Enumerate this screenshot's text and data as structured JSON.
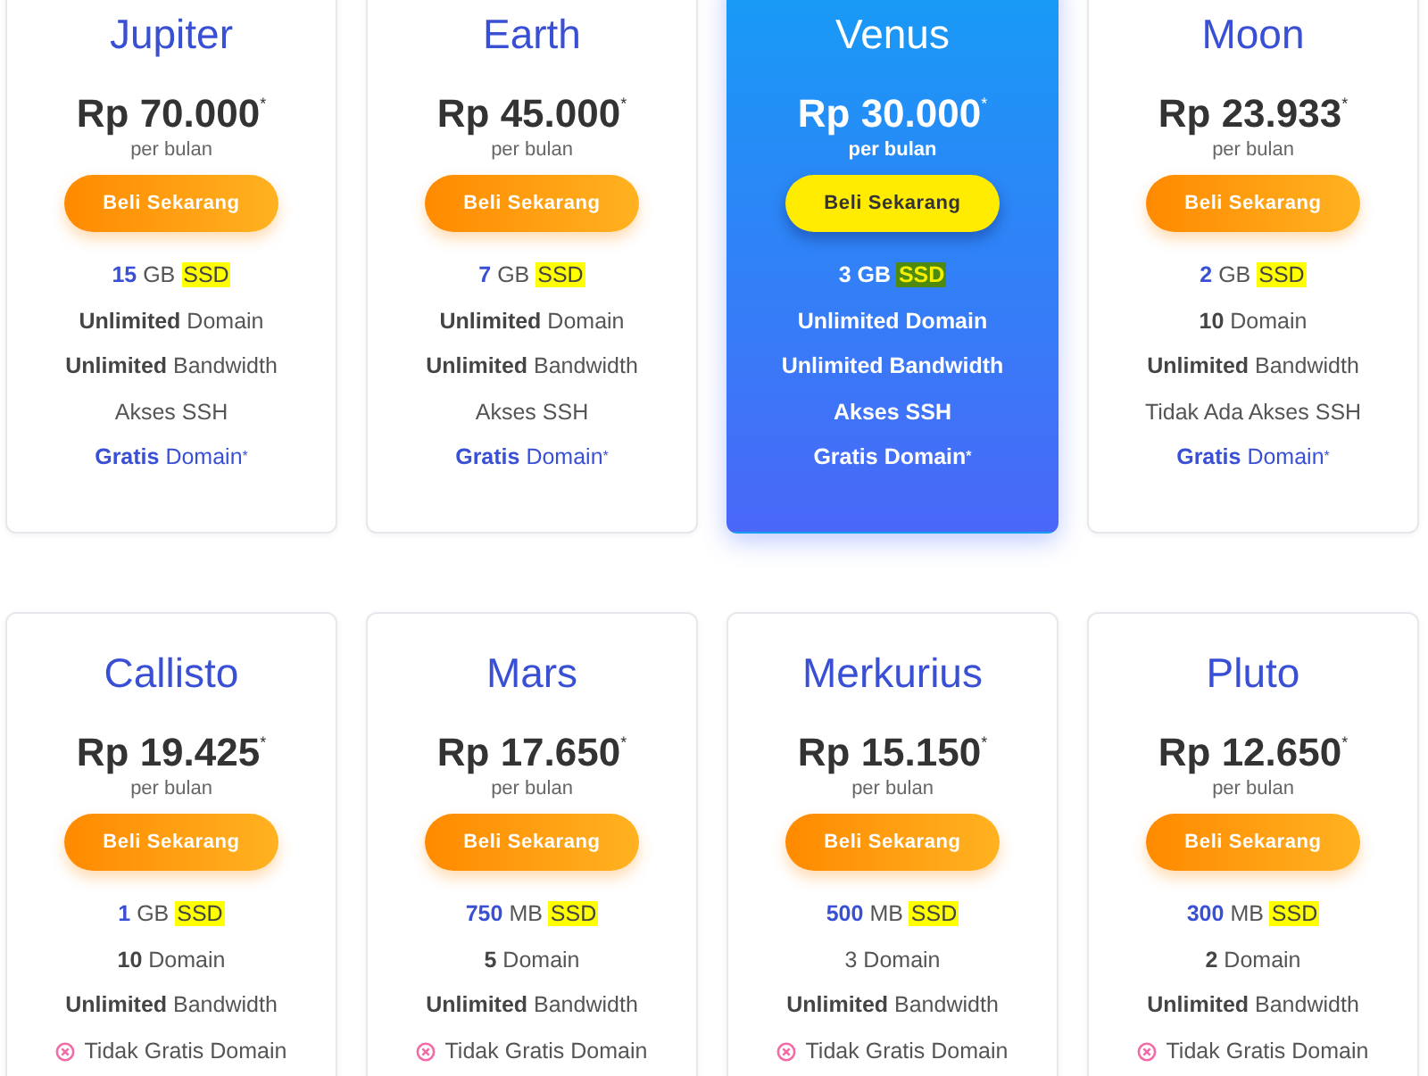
{
  "plans": [
    {
      "name": "Jupiter",
      "price": "Rp 70.000$^{*}$",
      "period": "per bulan",
      "button": "Beli Sekarang",
      "highlighted": false,
      "features": [
        {
          "kind": "storage",
          "amount": "15",
          "unit": "GB",
          "tag": "SSD"
        },
        {
          "kind": "text",
          "text": "**Unlimited** Domain"
        },
        {
          "kind": "text",
          "text": "**Unlimited** Bandwidth"
        },
        {
          "kind": "text",
          "text": "Akses SSH"
        },
        {
          "kind": "promo",
          "text": "**Gratis** Domain$^{*}$"
        }
      ]
    },
    {
      "name": "Earth",
      "price": "Rp 45.000$^{*}$",
      "period": "per bulan",
      "button": "Beli Sekarang",
      "highlighted": false,
      "features": [
        {
          "kind": "storage",
          "amount": "7",
          "unit": "GB",
          "tag": "SSD"
        },
        {
          "kind": "text",
          "text": "**Unlimited** Domain"
        },
        {
          "kind": "text",
          "text": "**Unlimited** Bandwidth"
        },
        {
          "kind": "text",
          "text": "Akses SSH"
        },
        {
          "kind": "promo",
          "text": "**Gratis** Domain$^{*}$"
        }
      ]
    },
    {
      "name": "Venus",
      "price": "Rp 30.000$^{*}$",
      "period": "per bulan",
      "button": "Beli Sekarang",
      "highlighted": true,
      "features": [
        {
          "kind": "storage",
          "amount": "3",
          "unit": "GB",
          "tag": "SSD"
        },
        {
          "kind": "text",
          "text": "**Unlimited Domain**"
        },
        {
          "kind": "text",
          "text": "**Unlimited Bandwidth**"
        },
        {
          "kind": "text",
          "text": "Akses SSH"
        },
        {
          "kind": "promo",
          "text": "**Gratis** Domain$^{*}$"
        }
      ]
    },
    {
      "name": "Moon",
      "price": "Rp 23.933$^{*}$",
      "period": "per bulan",
      "button": "Beli Sekarang",
      "highlighted": false,
      "features": [
        {
          "kind": "storage",
          "amount": "2",
          "unit": "GB",
          "tag": "SSD"
        },
        {
          "kind": "text",
          "text": "**10** Domain"
        },
        {
          "kind": "text",
          "text": "**Unlimited** Bandwidth"
        },
        {
          "kind": "text",
          "text": "Tidak Ada Akses SSH"
        },
        {
          "kind": "promo",
          "text": "**Gratis** Domain$^{*}$"
        }
      ]
    },
    {
      "name": "Callisto",
      "price": "Rp 19.425$^{*}$",
      "period": "per bulan",
      "button": "Beli Sekarang",
      "highlighted": false,
      "features": [
        {
          "kind": "storage",
          "amount": "1",
          "unit": "GB",
          "tag": "SSD"
        },
        {
          "kind": "text",
          "text": "**10** Domain"
        },
        {
          "kind": "text",
          "text": "**Unlimited** Bandwidth"
        },
        {
          "kind": "excluded",
          "text": "Tidak Gratis Domain"
        }
      ]
    },
    {
      "name": "Mars",
      "price": "Rp 17.650$^{*}$",
      "period": "per bulan",
      "button": "Beli Sekarang",
      "highlighted": false,
      "features": [
        {
          "kind": "storage",
          "amount": "750",
          "unit": "MB",
          "tag": "SSD"
        },
        {
          "kind": "text",
          "text": "**5** Domain"
        },
        {
          "kind": "text",
          "text": "**Unlimited** Bandwidth"
        },
        {
          "kind": "excluded",
          "text": "Tidak Gratis Domain"
        }
      ]
    },
    {
      "name": "Merkurius",
      "price": "Rp 15.150$^{*}$",
      "period": "per bulan",
      "button": "Beli Sekarang",
      "highlighted": false,
      "features": [
        {
          "kind": "storage",
          "amount": "500",
          "unit": "MB",
          "tag": "SSD"
        },
        {
          "kind": "text",
          "text": "3 Domain"
        },
        {
          "kind": "text",
          "text": "**Unlimited** Bandwidth"
        },
        {
          "kind": "excluded",
          "text": "Tidak Gratis Domain"
        }
      ]
    },
    {
      "name": "Pluto",
      "price": "Rp 12.650$^{*}$",
      "period": "per bulan",
      "button": "Beli Sekarang",
      "highlighted": false,
      "features": [
        {
          "kind": "storage",
          "amount": "300",
          "unit": "MB",
          "tag": "SSD"
        },
        {
          "kind": "text",
          "text": "**2** Domain"
        },
        {
          "kind": "text",
          "text": "**Unlimited** Bandwidth"
        },
        {
          "kind": "excluded",
          "text": "Tidak Gratis Domain"
        }
      ]
    }
  ]
}
